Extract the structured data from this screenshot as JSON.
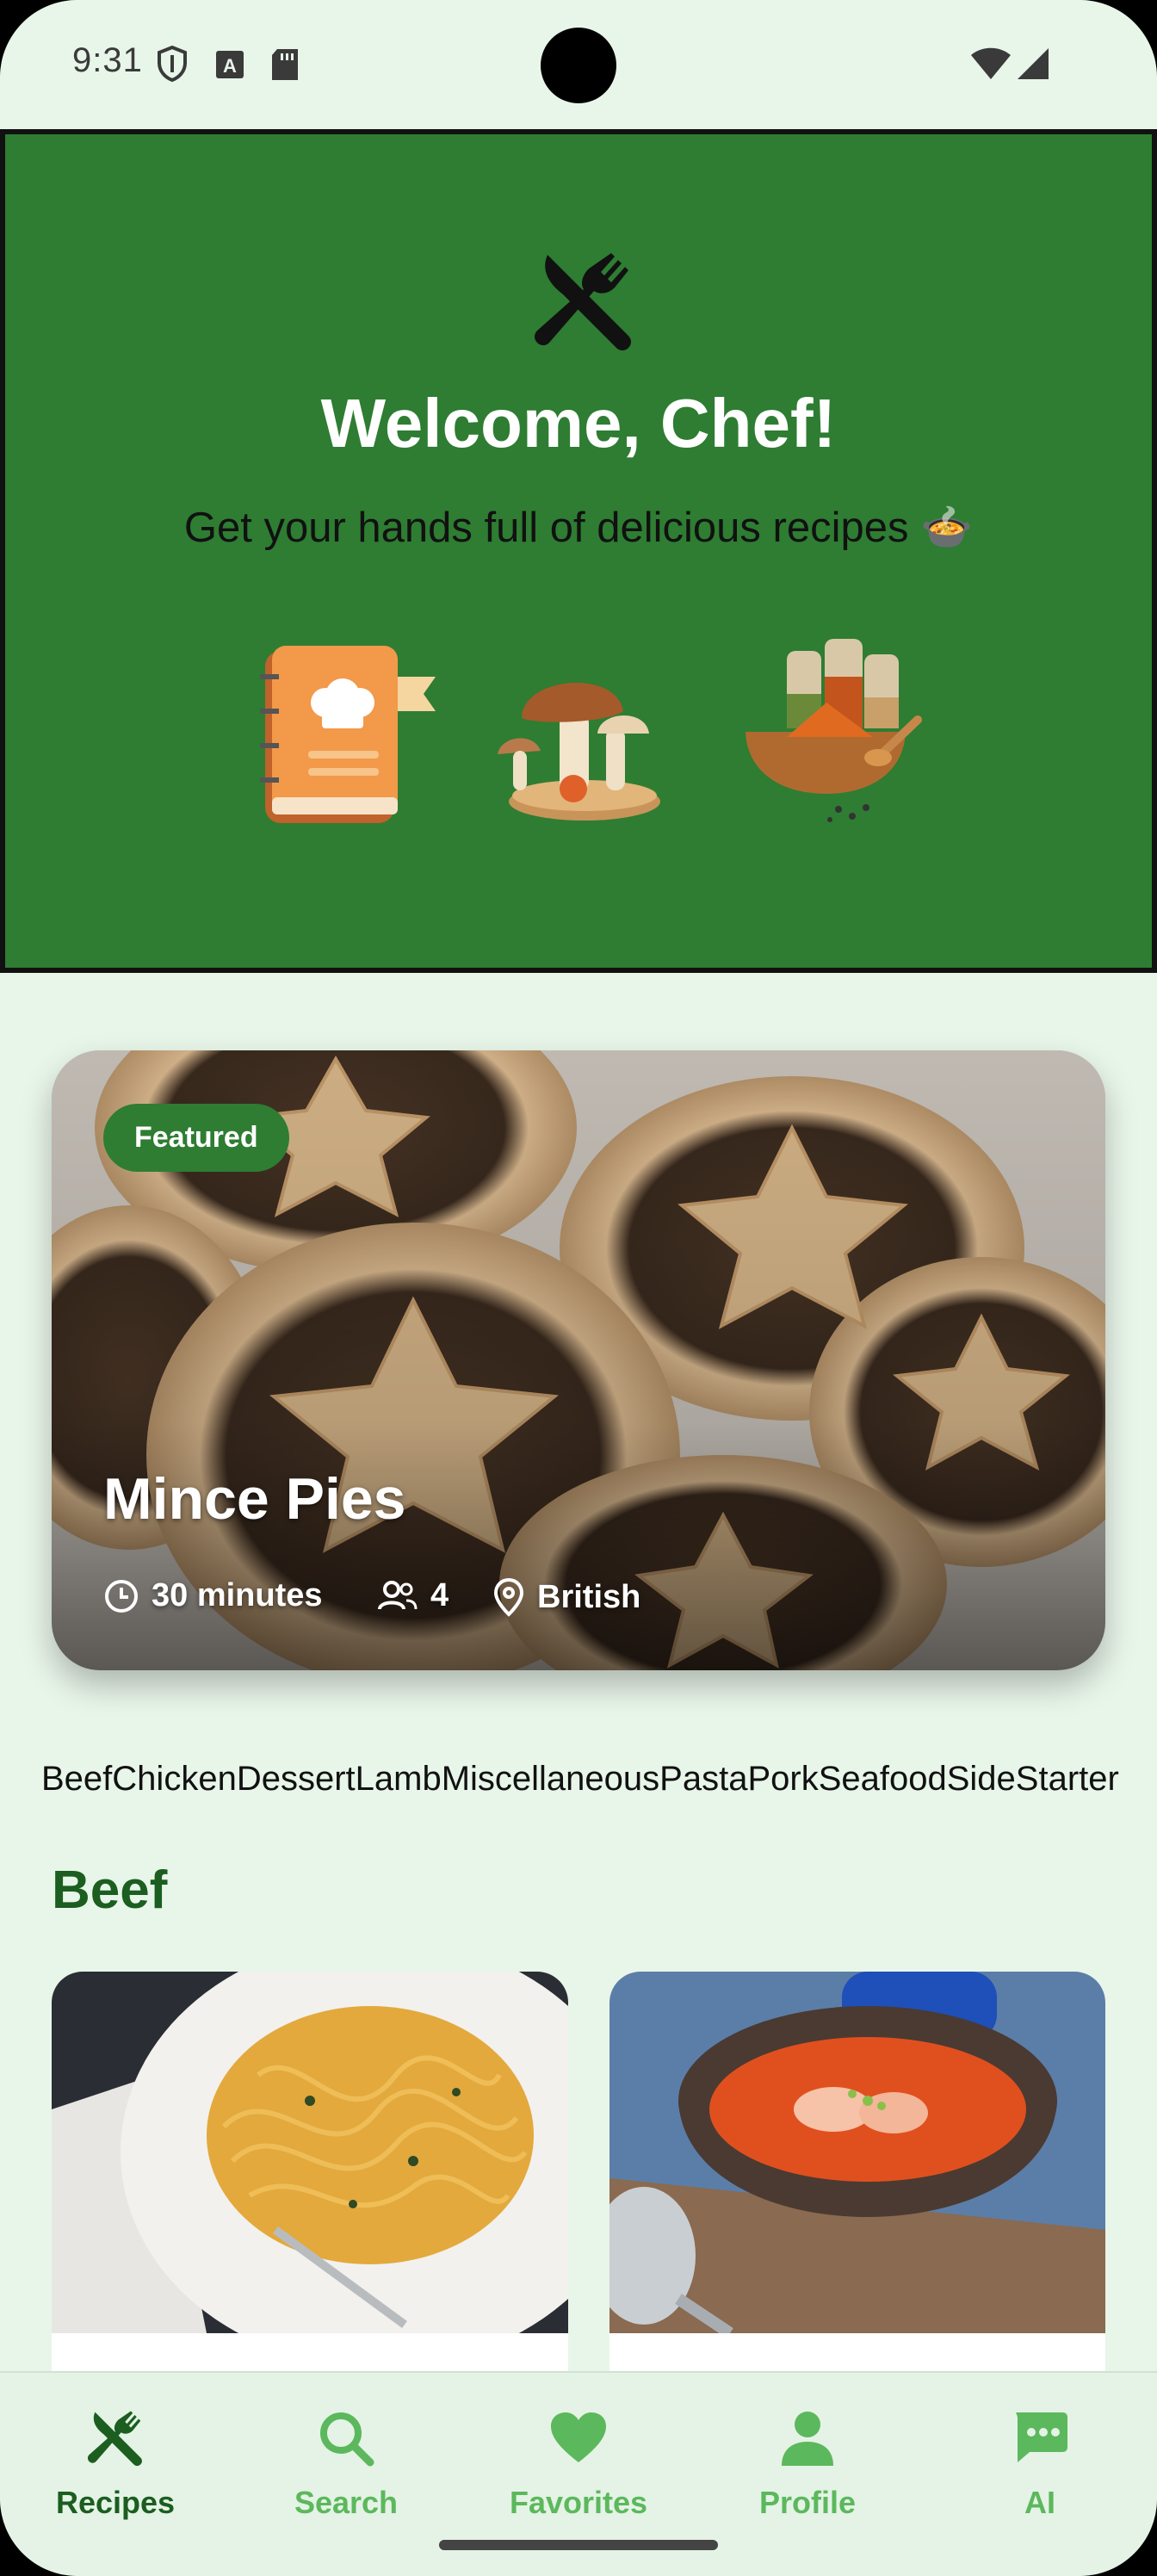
{
  "status_bar": {
    "time": "9:31",
    "icons": [
      "shield-icon",
      "a-icon",
      "sd-card-icon",
      "wifi-icon",
      "signal-icon"
    ]
  },
  "hero": {
    "logo_icon": "fork-knife-icon",
    "title": "Welcome, Chef!",
    "subtitle": "Get your hands full of delicious recipes 🍲",
    "illustrations": [
      "cookbook-icon",
      "mushrooms-icon",
      "spices-icon"
    ],
    "background_color": "#2e7d32"
  },
  "featured": {
    "badge": "Featured",
    "title": "Mince Pies",
    "time": "30 minutes",
    "servings": "4",
    "cuisine": "British"
  },
  "categories": [
    "Beef",
    "Chicken",
    "Dessert",
    "Lamb",
    "Miscellaneous",
    "Pasta",
    "Pork",
    "Seafood",
    "Side",
    "Starter"
  ],
  "section": {
    "title": "Beef"
  },
  "recipes": [
    {
      "image": "pasta-dish-photo"
    },
    {
      "image": "tomato-soup-photo"
    }
  ],
  "bottom_nav": {
    "items": [
      {
        "label": "Recipes",
        "icon": "fork-knife-icon",
        "active": true
      },
      {
        "label": "Search",
        "icon": "search-icon",
        "active": false
      },
      {
        "label": "Favorites",
        "icon": "heart-icon",
        "active": false
      },
      {
        "label": "Profile",
        "icon": "person-icon",
        "active": false
      },
      {
        "label": "AI",
        "icon": "chat-icon",
        "active": false
      }
    ],
    "active_color": "#1b5e20",
    "inactive_color": "#5cb85c"
  }
}
